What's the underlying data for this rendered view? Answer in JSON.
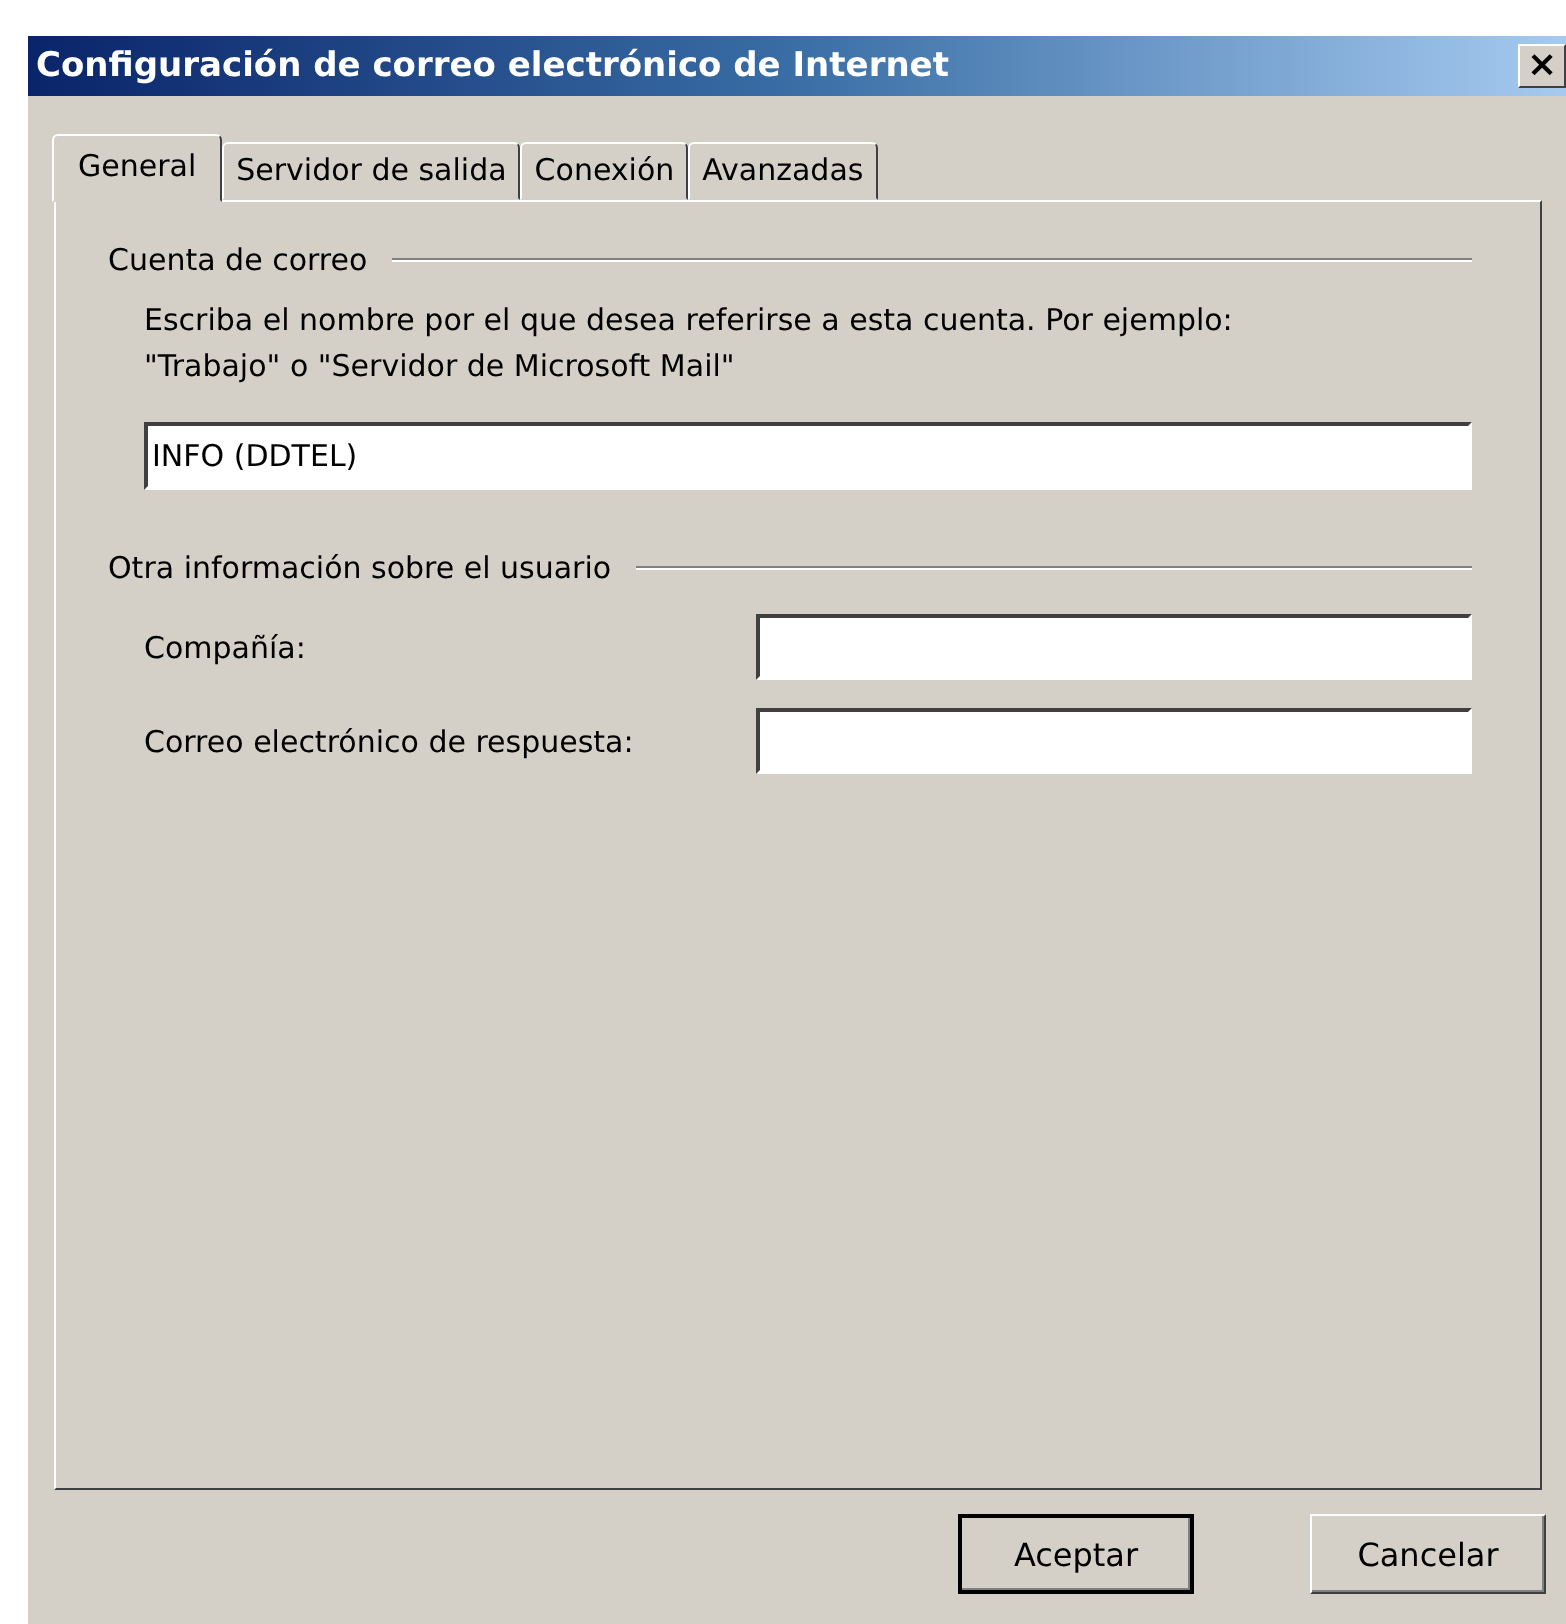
{
  "window": {
    "title": "Configuración de correo electrónico de Internet",
    "close": "×"
  },
  "tabs": [
    {
      "label": "General",
      "selected": true
    },
    {
      "label": "Servidor de salida",
      "selected": false
    },
    {
      "label": "Conexión",
      "selected": false
    },
    {
      "label": "Avanzadas",
      "selected": false
    }
  ],
  "account": {
    "heading": "Cuenta de correo",
    "description": "Escriba el nombre por el que desea referirse a esta cuenta. Por ejemplo: \"Trabajo\" o \"Servidor de Microsoft Mail\"",
    "value": "INFO (DDTEL)"
  },
  "user_info": {
    "heading": "Otra información sobre el usuario",
    "fields": [
      {
        "label": "Compañía:"
      },
      {
        "label": "Correo electrónico de respuesta:"
      }
    ]
  },
  "buttons": [
    {
      "label": "Aceptar",
      "default": true
    },
    {
      "label": "Cancelar",
      "default": false
    }
  ]
}
